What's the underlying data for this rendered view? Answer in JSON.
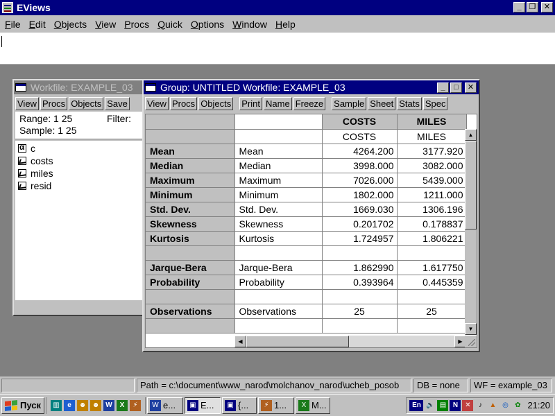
{
  "app": {
    "title": "EViews"
  },
  "window_controls": {
    "minimize": "_",
    "restore": "❐",
    "close": "✕"
  },
  "menu": [
    {
      "label": "File",
      "hotkey": "F",
      "rest": "ile"
    },
    {
      "label": "Edit",
      "hotkey": "E",
      "rest": "dit"
    },
    {
      "label": "Objects",
      "hotkey": "O",
      "rest": "bjects"
    },
    {
      "label": "View",
      "hotkey": "V",
      "rest": "iew"
    },
    {
      "label": "Procs",
      "hotkey": "P",
      "rest": "rocs"
    },
    {
      "label": "Quick",
      "hotkey": "Q",
      "rest": "uick"
    },
    {
      "label": "Options",
      "hotkey": "O",
      "rest": "ptions"
    },
    {
      "label": "Window",
      "hotkey": "W",
      "rest": "indow"
    },
    {
      "label": "Help",
      "hotkey": "H",
      "rest": "elp"
    }
  ],
  "workfile": {
    "title": "Workfile: EXAMPLE_03",
    "toolbar": [
      "View",
      "Procs",
      "Objects",
      "Save"
    ],
    "range": "Range:  1 25",
    "filter": "Filter:",
    "sample": "Sample: 1 25",
    "objects": [
      {
        "name": "c",
        "icon": "alpha-icon"
      },
      {
        "name": "costs",
        "icon": "series-icon"
      },
      {
        "name": "miles",
        "icon": "series-icon"
      },
      {
        "name": "resid",
        "icon": "series-icon"
      }
    ]
  },
  "group": {
    "title": "Group: UNTITLED   Workfile: EXAMPLE_03",
    "toolbar_left": [
      "View",
      "Procs",
      "Objects"
    ],
    "toolbar_mid": [
      "Print",
      "Name",
      "Freeze"
    ],
    "toolbar_right": [
      "Sample",
      "Sheet",
      "Stats",
      "Spec"
    ],
    "columns": [
      "COSTS",
      "MILES"
    ],
    "subheaders": [
      "COSTS",
      "MILES"
    ],
    "rows": [
      {
        "label": "Mean",
        "name": "Mean",
        "costs": "4264.200",
        "miles": "3177.920"
      },
      {
        "label": "Median",
        "name": "Median",
        "costs": "3998.000",
        "miles": "3082.000"
      },
      {
        "label": "Maximum",
        "name": "Maximum",
        "costs": "7026.000",
        "miles": "5439.000"
      },
      {
        "label": "Minimum",
        "name": "Minimum",
        "costs": "1802.000",
        "miles": "1211.000"
      },
      {
        "label": "Std. Dev.",
        "name": "Std. Dev.",
        "costs": "1669.030",
        "miles": "1306.196"
      },
      {
        "label": "Skewness",
        "name": "Skewness",
        "costs": "0.201702",
        "miles": "0.178837"
      },
      {
        "label": "Kurtosis",
        "name": "Kurtosis",
        "costs": "1.724957",
        "miles": "1.806221"
      },
      {
        "label": "",
        "name": "",
        "costs": "",
        "miles": ""
      },
      {
        "label": "Jarque-Bera",
        "name": "Jarque-Bera",
        "costs": "1.862990",
        "miles": "1.617750"
      },
      {
        "label": "Probability",
        "name": "Probability",
        "costs": "0.393964",
        "miles": "0.445359"
      },
      {
        "label": "",
        "name": "",
        "costs": "",
        "miles": ""
      },
      {
        "label": "Observations",
        "name": "Observations",
        "costs": "25",
        "miles": "25",
        "center": true
      },
      {
        "label": "",
        "name": "",
        "costs": "",
        "miles": ""
      }
    ]
  },
  "statusbar": {
    "path": "Path = c:\\document\\www_narod\\molchanov_narod\\ucheb_posob",
    "db": "DB = none",
    "wf": "WF = example_03"
  },
  "taskbar": {
    "start_label": "Пуск",
    "quick_launch": [
      "desktop-icon",
      "ie-icon",
      "app-icon",
      "app-icon",
      "word-icon",
      "excel-icon",
      "tool-icon"
    ],
    "tasks": [
      {
        "label": "e...",
        "icon": "word-icon",
        "active": false
      },
      {
        "label": "E...",
        "icon": "eviews-icon",
        "active": true
      },
      {
        "label": "{...",
        "icon": "window-icon",
        "active": false
      },
      {
        "label": "1...",
        "icon": "tool-icon",
        "active": false
      },
      {
        "label": "M...",
        "icon": "excel-icon",
        "active": false
      }
    ],
    "language": "En",
    "clock": "21:20"
  }
}
